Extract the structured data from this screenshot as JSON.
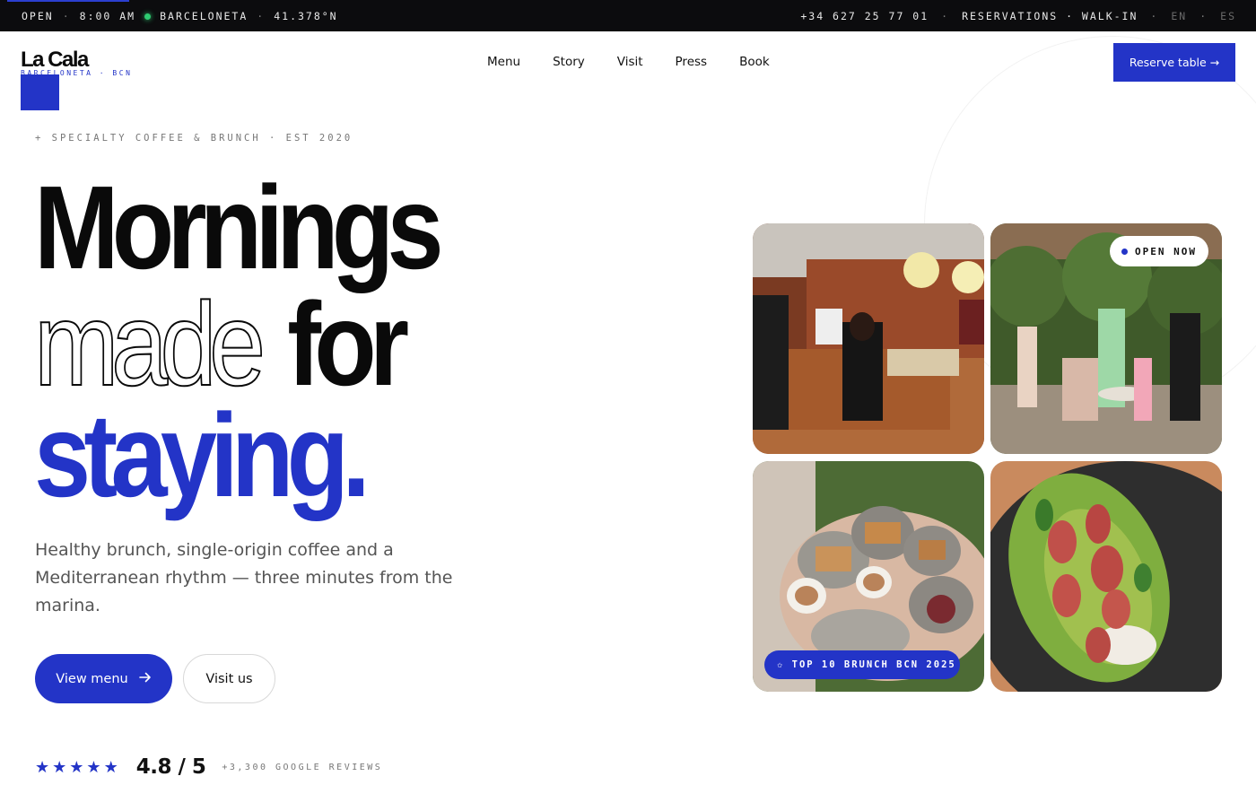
{
  "topbar": {
    "status": "OPEN",
    "time": "8:00 AM",
    "location": "BARCELONETA",
    "coords": "41.378°N",
    "phone": "+34 627 25 77 01",
    "reservations": "RESERVATIONS · WALK-IN",
    "lang_en": "EN",
    "lang_es": "ES"
  },
  "brand": {
    "name": "La Cala",
    "sub": "BARCELONETA · BCN"
  },
  "nav": {
    "items": [
      "Menu",
      "Story",
      "Visit",
      "Press",
      "Book"
    ]
  },
  "header": {
    "reserve_label": "Reserve table →"
  },
  "hero": {
    "eyebrow": "+ SPECIALTY COFFEE & BRUNCH · EST 2020",
    "line1": "Mornings",
    "line2_outline": "made",
    "line2_solid": "for",
    "line3": "staying.",
    "lede": "Healthy brunch, single-origin coffee and a Mediterranean rhythm — three minutes from the marina.",
    "cta_primary": "View menu",
    "cta_secondary": "Visit us"
  },
  "rating": {
    "stars": 5,
    "score": "4.8 / 5",
    "reviews": "+3,300 GOOGLE REVIEWS"
  },
  "gallery": {
    "badge_open": "OPEN NOW",
    "badge_award": "✩ TOP 10 BRUNCH BCN 2025"
  },
  "colors": {
    "accent": "#2334c7",
    "topbar_bg": "#0c0c0e",
    "status_dot": "#2ecc71"
  },
  "icons": {
    "arrow": "arrow-right-icon",
    "star": "star-icon"
  }
}
